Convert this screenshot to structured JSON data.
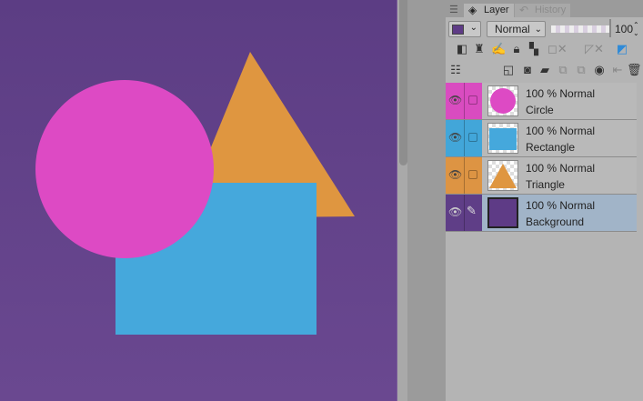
{
  "tabs": [
    {
      "label": "Layer",
      "icon": "layers-icon"
    },
    {
      "label": "History",
      "icon": "undo-icon"
    }
  ],
  "toolbar": {
    "blend_mode": "Normal",
    "opacity": "100",
    "layer_color": "#5e3b86"
  },
  "layers": [
    {
      "name": "Circle",
      "mode": "100 % Normal",
      "color": "#d94cc0",
      "selected": false
    },
    {
      "name": "Rectangle",
      "mode": "100 % Normal",
      "color": "#42a6d9",
      "selected": false
    },
    {
      "name": "Triangle",
      "mode": "100 % Normal",
      "color": "#dd9443",
      "selected": false
    },
    {
      "name": "Background",
      "mode": "100 % Normal",
      "color": "#5f3e87",
      "selected": true
    }
  ],
  "colors": {
    "canvas": "#5f3f86",
    "circle": "#dd4ac4",
    "rectangle": "#45a8dc",
    "triangle": "#df9640"
  }
}
